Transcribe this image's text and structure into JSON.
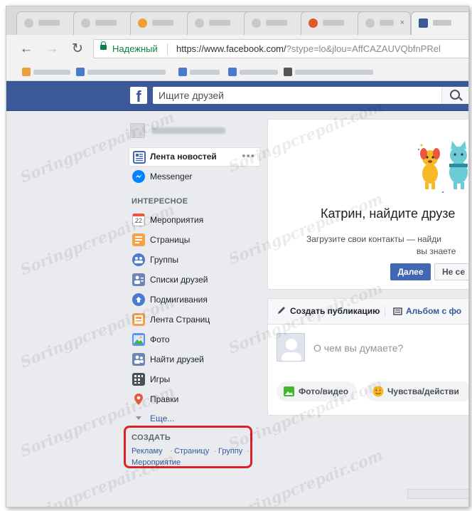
{
  "browser": {
    "secure_label": "Надежный",
    "url_main": "https://www.facebook.com/",
    "url_query": "?stype=lo&jlou=AffCAZAUVQbfnPRel"
  },
  "header": {
    "search_placeholder": "Ищите друзей",
    "logo_letter": "f"
  },
  "sidebar": {
    "news_feed": "Лента новостей",
    "messenger": "Messenger",
    "interesting_title": "ИНТЕРЕСНОЕ",
    "calendar_day": "22",
    "items": [
      "Мероприятия",
      "Страницы",
      "Группы",
      "Списки друзей",
      "Подмигивания",
      "Лента Страниц",
      "Фото",
      "Найти друзей",
      "Игры",
      "Правки"
    ],
    "more": "Еще..."
  },
  "create": {
    "title": "СОЗДАТЬ",
    "links": [
      "Рекламу",
      "Страницу",
      "Группу",
      "Мероприятие"
    ],
    "separator": "·"
  },
  "find_friends": {
    "title": "Катрин, найдите друзе",
    "subtitle_1": "Загрузите свои контакты — найди",
    "subtitle_2": "вы знаете",
    "next_button": "Далее",
    "not_now_button": "Не се"
  },
  "composer": {
    "create_post": "Создать публикацию",
    "album": "Альбом с фо",
    "placeholder": "О чем вы думаете?",
    "photo_video": "Фото/видео",
    "feelings": "Чувства/действи"
  },
  "watermark": "Soringpcrepair.com",
  "colors": {
    "fb_blue": "#3b5998",
    "link_blue": "#365899",
    "button_blue": "#4267b2",
    "highlight_red": "#d9232a",
    "secure_green": "#0b8043"
  }
}
